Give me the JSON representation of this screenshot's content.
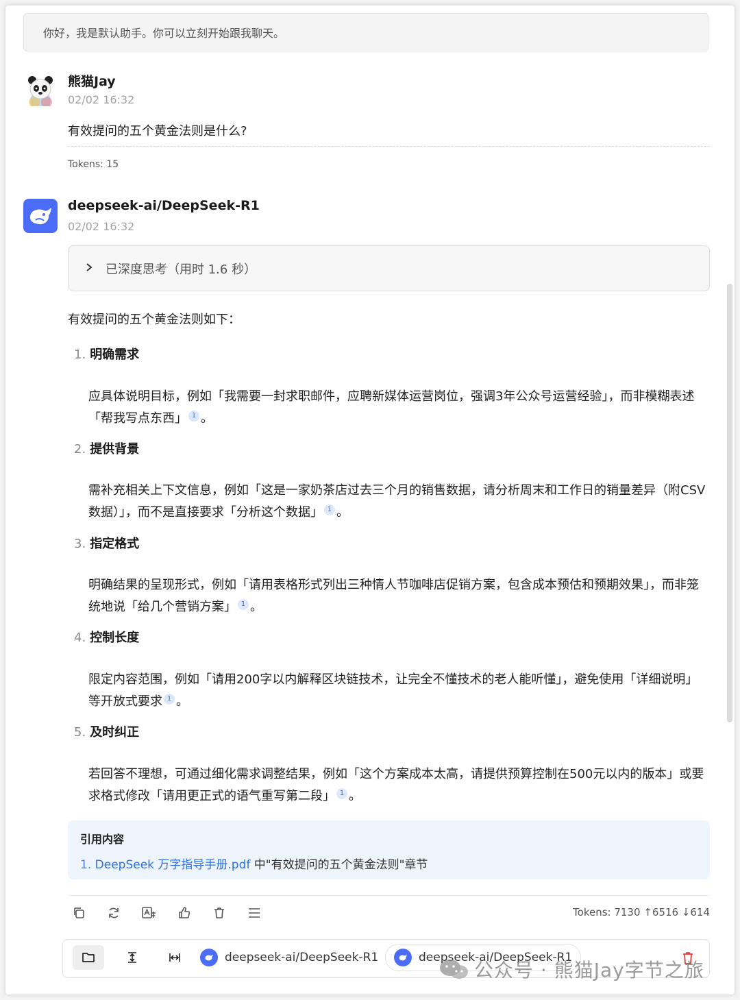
{
  "greeting": "你好，我是默认助手。你可以立刻开始跟我聊天。",
  "user_message": {
    "name": "熊猫Jay",
    "time": "02/02 16:32",
    "text": "有效提问的五个黄金法则是什么?",
    "tokens": "Tokens: 15"
  },
  "assistant_message": {
    "name": "deepseek-ai/DeepSeek-R1",
    "time": "02/02 16:32",
    "thinking": "已深度思考（用时 1.6 秒）",
    "intro": "有效提问的五个黄金法则如下：",
    "items": [
      {
        "num": "1.",
        "title": "明确需求",
        "body_before": "应具体说明目标，例如「我需要一封求职邮件，应聘新媒体运营岗位，强调3年公众号运营经验」，而非模糊表述「帮我写点东西」",
        "cite": "1",
        "body_after": "。"
      },
      {
        "num": "2.",
        "title": "提供背景",
        "body_before": "需补充相关上下文信息，例如「这是一家奶茶店过去三个月的销售数据，请分析周末和工作日的销量差异（附CSV数据）」，而不是直接要求「分析这个数据」",
        "cite": "1",
        "body_after": "。"
      },
      {
        "num": "3.",
        "title": "指定格式",
        "body_before": "明确结果的呈现形式，例如「请用表格形式列出三种情人节咖啡店促销方案，包含成本预估和预期效果」，而非笼统地说「给几个营销方案」",
        "cite": "1",
        "body_after": "。"
      },
      {
        "num": "4.",
        "title": "控制长度",
        "body_before": "限定内容范围，例如「请用200字以内解释区块链技术，让完全不懂技术的老人能听懂」，避免使用「详细说明」等开放式要求",
        "cite": "1",
        "body_after": "。"
      },
      {
        "num": "5.",
        "title": "及时纠正",
        "body_before": "若回答不理想，可通过细化需求调整结果，例如「这个方案成本太高，请提供预算控制在500元以内的版本」或要求格式修改「请用更正式的语气重写第二段」",
        "cite": "1",
        "body_after": "。"
      }
    ],
    "references": {
      "title": "引用内容",
      "num": "1.",
      "link": "DeepSeek 万字指导手册.pdf",
      "suffix": " 中\"有效提问的五个黄金法则\"章节"
    },
    "tokens": "Tokens: 7130 ↑6516 ↓614",
    "actions": [
      "copy-icon",
      "regenerate-icon",
      "translate-icon",
      "thumbs-up-icon",
      "delete-icon",
      "menu-icon"
    ]
  },
  "bottom_bar": {
    "icons": [
      "folder-icon",
      "text-height-icon",
      "text-width-icon"
    ],
    "model_1": "deepseek-ai/DeepSeek-R1",
    "model_2": "deepseek-ai/DeepSeek-R1"
  },
  "watermark": "公众号 · 熊猫Jay字节之旅",
  "colors": {
    "accent": "#4a6cf7",
    "link": "#2f6fe0",
    "reference_bg": "#eef4fc",
    "delete_red": "#e53935"
  }
}
